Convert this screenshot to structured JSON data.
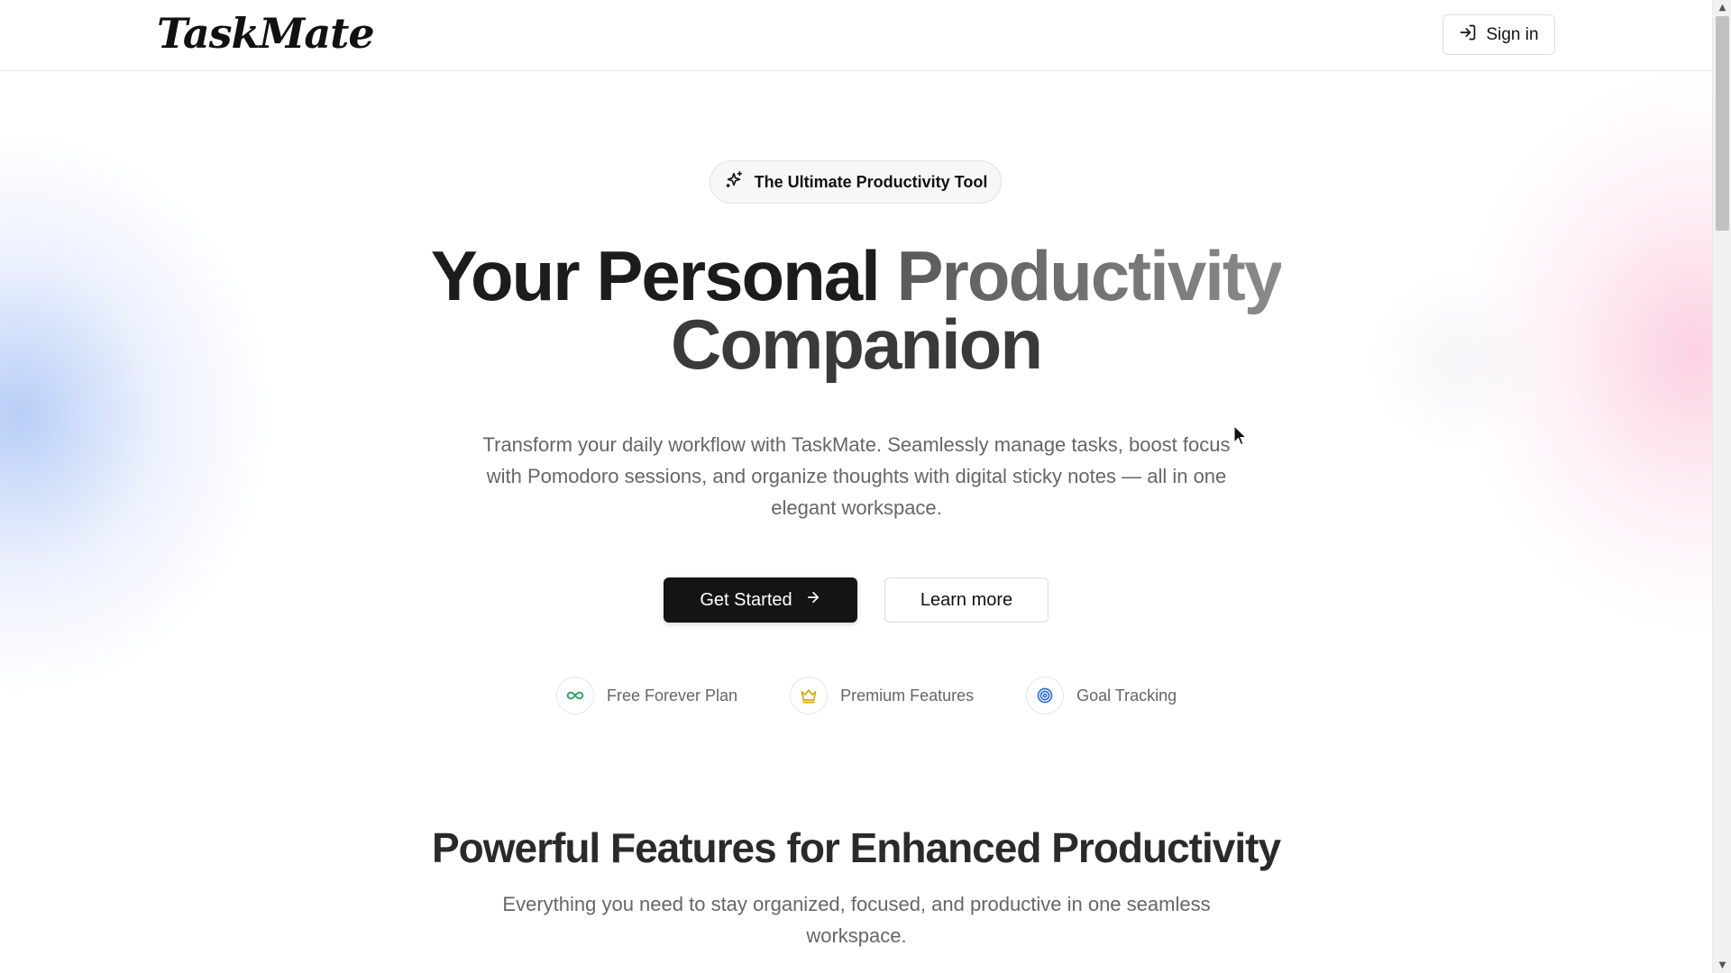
{
  "brand": {
    "logo_text": "TaskMate"
  },
  "header": {
    "signin_label": "Sign in",
    "signin_icon": "login-icon"
  },
  "hero": {
    "badge_icon": "sparkles-icon",
    "badge_text": "The Ultimate Productivity Tool",
    "title_part1": "Your Personal ",
    "title_part2": "Productivity",
    "title_line2": "Companion",
    "description": "Transform your daily workflow with TaskMate. Seamlessly manage tasks, boost focus with Pomodoro sessions, and organize thoughts with digital sticky notes — all in one elegant workspace.",
    "primary_cta": "Get Started",
    "secondary_cta": "Learn more"
  },
  "highlights": [
    {
      "label": "Free Forever Plan",
      "icon": "infinity-icon",
      "color": "#22a55a"
    },
    {
      "label": "Premium Features",
      "icon": "crown-icon",
      "color": "#e0a800"
    },
    {
      "label": "Goal Tracking",
      "icon": "target-icon",
      "color": "#2f6fde"
    }
  ],
  "features": {
    "title": "Powerful Features for Enhanced Productivity",
    "description": "Everything you need to stay organized, focused, and productive in one seamless workspace."
  }
}
